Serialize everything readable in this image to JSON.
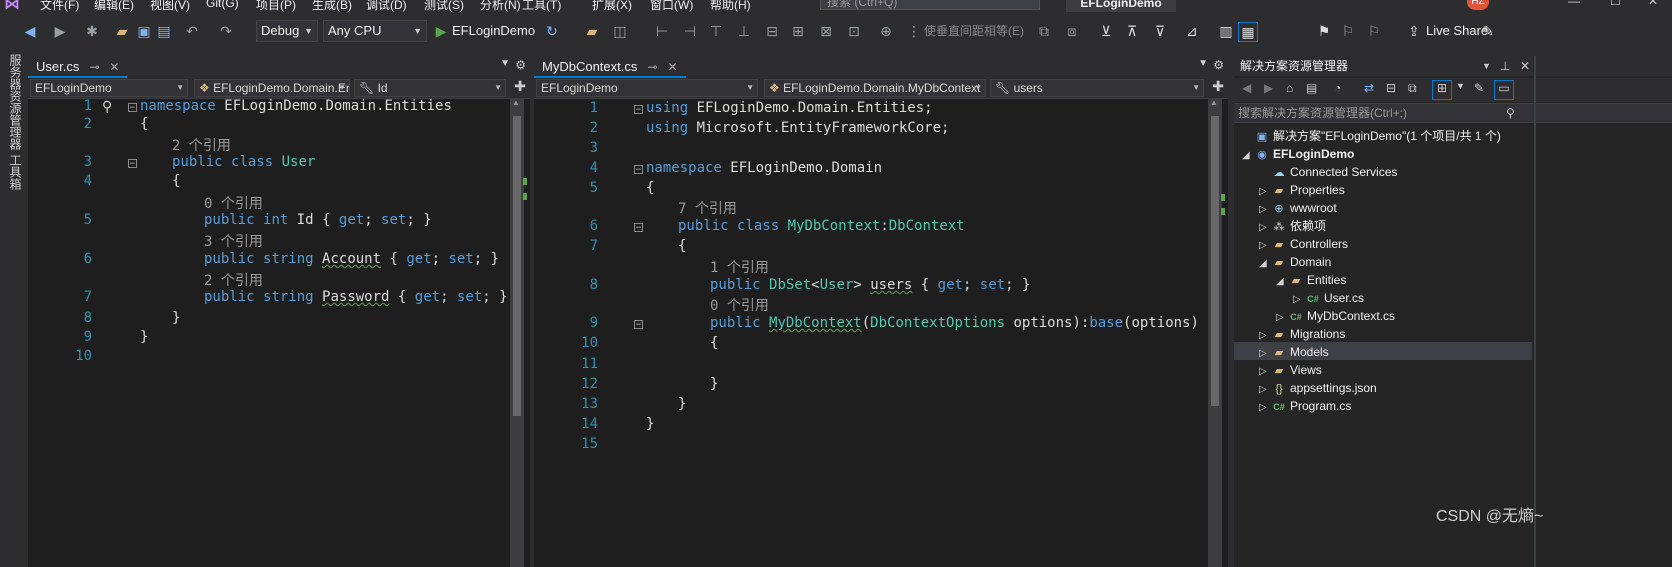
{
  "menu": {
    "items": [
      "文件(F)",
      "编辑(E)",
      "视图(V)",
      "Git(G)",
      "项目(P)",
      "生成(B)",
      "调试(D)",
      "测试(S)",
      "分析(N)",
      "工具(T)",
      "扩展(X)",
      "窗口(W)",
      "帮助(H)"
    ],
    "search_placeholder": "搜索 (Ctrl+Q)",
    "app_title": "EFLoginDemo",
    "user_initials": "HZ"
  },
  "toolbar": {
    "config": "Debug",
    "platform": "Any CPU",
    "run_target": "EFLoginDemo",
    "spacing_label": "使垂直间距相等(E)",
    "live_share": "Live Share"
  },
  "left_strip": {
    "server_explorer": "服务器资源管理器",
    "toolbox": "工具箱"
  },
  "left_editor": {
    "tab": "User.cs",
    "nav_project": "EFLoginDemo",
    "nav_class": "EFLoginDemo.Domain.Entities.User",
    "nav_member": "Id",
    "lines": [
      {
        "n": "1",
        "parts": [
          {
            "t": "namespace ",
            "c": "kw"
          },
          {
            "t": "EFLoginDemo.Domain.Entities",
            "c": "id"
          }
        ]
      },
      {
        "n": "2",
        "parts": [
          {
            "t": "{",
            "c": "id"
          }
        ]
      },
      {
        "n": "",
        "lens": "2 个引用",
        "indent": 1
      },
      {
        "n": "3",
        "indent": 1,
        "parts": [
          {
            "t": "public ",
            "c": "kw"
          },
          {
            "t": "class ",
            "c": "kw"
          },
          {
            "t": "User",
            "c": "ty"
          }
        ]
      },
      {
        "n": "4",
        "indent": 1,
        "parts": [
          {
            "t": "{",
            "c": "id"
          }
        ]
      },
      {
        "n": "",
        "lens": "0 个引用",
        "indent": 2
      },
      {
        "n": "5",
        "indent": 2,
        "parts": [
          {
            "t": "public ",
            "c": "kw"
          },
          {
            "t": "int ",
            "c": "kw"
          },
          {
            "t": "Id { ",
            "c": "id"
          },
          {
            "t": "get",
            "c": "kw"
          },
          {
            "t": "; ",
            "c": "id"
          },
          {
            "t": "set",
            "c": "kw"
          },
          {
            "t": "; }",
            "c": "id"
          }
        ]
      },
      {
        "n": "",
        "lens": "3 个引用",
        "indent": 2
      },
      {
        "n": "6",
        "indent": 2,
        "parts": [
          {
            "t": "public ",
            "c": "kw"
          },
          {
            "t": "string ",
            "c": "kw"
          },
          {
            "t": "Account",
            "c": "id squig"
          },
          {
            "t": " { ",
            "c": "id"
          },
          {
            "t": "get",
            "c": "kw"
          },
          {
            "t": "; ",
            "c": "id"
          },
          {
            "t": "set",
            "c": "kw"
          },
          {
            "t": "; }",
            "c": "id"
          }
        ]
      },
      {
        "n": "",
        "lens": "2 个引用",
        "indent": 2
      },
      {
        "n": "7",
        "indent": 2,
        "parts": [
          {
            "t": "public ",
            "c": "kw"
          },
          {
            "t": "string ",
            "c": "kw"
          },
          {
            "t": "Password",
            "c": "id squig"
          },
          {
            "t": " { ",
            "c": "id"
          },
          {
            "t": "get",
            "c": "kw"
          },
          {
            "t": "; ",
            "c": "id"
          },
          {
            "t": "set",
            "c": "kw"
          },
          {
            "t": "; }",
            "c": "id"
          }
        ]
      },
      {
        "n": "8",
        "indent": 1,
        "parts": [
          {
            "t": "}",
            "c": "id"
          }
        ]
      },
      {
        "n": "9",
        "parts": [
          {
            "t": "}",
            "c": "id"
          }
        ]
      },
      {
        "n": "10",
        "parts": []
      }
    ]
  },
  "right_editor": {
    "tab": "MyDbContext.cs",
    "nav_project": "EFLoginDemo",
    "nav_class": "EFLoginDemo.Domain.MyDbContext",
    "nav_member": "users",
    "lines": [
      {
        "n": "1",
        "parts": [
          {
            "t": "using ",
            "c": "kw"
          },
          {
            "t": "EFLoginDemo.Domain.Entities;",
            "c": "id"
          }
        ]
      },
      {
        "n": "2",
        "parts": [
          {
            "t": "using ",
            "c": "kw"
          },
          {
            "t": "Microsoft.EntityFrameworkCore;",
            "c": "id"
          }
        ]
      },
      {
        "n": "3",
        "parts": []
      },
      {
        "n": "4",
        "parts": [
          {
            "t": "namespace ",
            "c": "kw"
          },
          {
            "t": "EFLoginDemo.Domain",
            "c": "id"
          }
        ]
      },
      {
        "n": "5",
        "parts": [
          {
            "t": "{",
            "c": "id"
          }
        ]
      },
      {
        "n": "",
        "lens": "7 个引用",
        "indent": 1
      },
      {
        "n": "6",
        "indent": 1,
        "parts": [
          {
            "t": "public ",
            "c": "kw"
          },
          {
            "t": "class ",
            "c": "kw"
          },
          {
            "t": "MyDbContext",
            "c": "ty"
          },
          {
            "t": ":",
            "c": "id"
          },
          {
            "t": "DbContext",
            "c": "ty"
          }
        ]
      },
      {
        "n": "7",
        "indent": 1,
        "parts": [
          {
            "t": "{",
            "c": "id"
          }
        ]
      },
      {
        "n": "",
        "lens": "1 个引用",
        "indent": 2
      },
      {
        "n": "8",
        "indent": 2,
        "parts": [
          {
            "t": "public ",
            "c": "kw"
          },
          {
            "t": "DbSet",
            "c": "ty"
          },
          {
            "t": "<",
            "c": "id"
          },
          {
            "t": "User",
            "c": "ty"
          },
          {
            "t": "> ",
            "c": "id"
          },
          {
            "t": "users",
            "c": "id squig"
          },
          {
            "t": " { ",
            "c": "id"
          },
          {
            "t": "get",
            "c": "kw"
          },
          {
            "t": "; ",
            "c": "id"
          },
          {
            "t": "set",
            "c": "kw"
          },
          {
            "t": "; }",
            "c": "id"
          }
        ]
      },
      {
        "n": "",
        "lens": "0 个引用",
        "indent": 2
      },
      {
        "n": "9",
        "indent": 2,
        "parts": [
          {
            "t": "public ",
            "c": "kw"
          },
          {
            "t": "MyDbContext",
            "c": "ty squig"
          },
          {
            "t": "(",
            "c": "id"
          },
          {
            "t": "DbContextOptions",
            "c": "ty"
          },
          {
            "t": " options):",
            "c": "id"
          },
          {
            "t": "base",
            "c": "kw"
          },
          {
            "t": "(options)",
            "c": "id"
          }
        ]
      },
      {
        "n": "10",
        "indent": 2,
        "parts": [
          {
            "t": "{",
            "c": "id"
          }
        ]
      },
      {
        "n": "11",
        "parts": []
      },
      {
        "n": "12",
        "indent": 2,
        "parts": [
          {
            "t": "}",
            "c": "id"
          }
        ]
      },
      {
        "n": "13",
        "indent": 1,
        "parts": [
          {
            "t": "}",
            "c": "id"
          }
        ]
      },
      {
        "n": "14",
        "parts": [
          {
            "t": "}",
            "c": "id"
          }
        ]
      },
      {
        "n": "15",
        "parts": []
      }
    ]
  },
  "solution_explorer": {
    "title": "解决方案资源管理器",
    "search_placeholder": "搜索解决方案资源管理器(Ctrl+;)",
    "items": [
      {
        "label": "解决方案\"EFLoginDemo\"(1 个项目/共 1 个)",
        "depth": 0,
        "tri": "",
        "icon": "solution-icon"
      },
      {
        "label": "EFLoginDemo",
        "depth": 0,
        "tri": "open",
        "icon": "project-icon",
        "bold": true
      },
      {
        "label": "Connected Services",
        "depth": 1,
        "tri": "",
        "icon": "connected-services-icon"
      },
      {
        "label": "Properties",
        "depth": 1,
        "tri": "closed",
        "icon": "folder-icon"
      },
      {
        "label": "wwwroot",
        "depth": 1,
        "tri": "closed",
        "icon": "globe-icon"
      },
      {
        "label": "依赖项",
        "depth": 1,
        "tri": "closed",
        "icon": "dependencies-icon"
      },
      {
        "label": "Controllers",
        "depth": 1,
        "tri": "closed",
        "icon": "folder-icon"
      },
      {
        "label": "Domain",
        "depth": 1,
        "tri": "open",
        "icon": "folder-icon"
      },
      {
        "label": "Entities",
        "depth": 2,
        "tri": "open",
        "icon": "folder-icon"
      },
      {
        "label": "User.cs",
        "depth": 3,
        "tri": "closed",
        "icon": "csharp-file-icon",
        "selected": true
      },
      {
        "label": "MyDbContext.cs",
        "depth": 2,
        "tri": "closed",
        "icon": "csharp-file-icon"
      },
      {
        "label": "Migrations",
        "depth": 1,
        "tri": "closed",
        "icon": "folder-icon"
      },
      {
        "label": "Models",
        "depth": 1,
        "tri": "closed",
        "icon": "folder-icon"
      },
      {
        "label": "Views",
        "depth": 1,
        "tri": "closed",
        "icon": "folder-icon"
      },
      {
        "label": "appsettings.json",
        "depth": 1,
        "tri": "closed",
        "icon": "json-file-icon"
      },
      {
        "label": "Program.cs",
        "depth": 1,
        "tri": "closed",
        "icon": "csharp-file-icon"
      }
    ]
  },
  "watermark": "CSDN @无熵~",
  "colors": {
    "keyword": "#569cd6",
    "type": "#4ec9b0",
    "line_number": "#2b91af",
    "accent": "#007acc"
  }
}
